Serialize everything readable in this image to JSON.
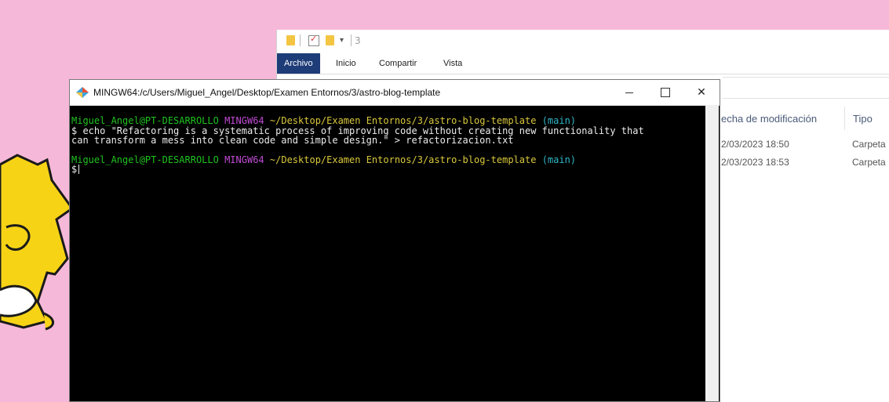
{
  "desktop": {
    "background": "#f6b8d8"
  },
  "explorer": {
    "qa_title": "3",
    "ribbon_tabs": [
      "Archivo",
      "Inicio",
      "Compartir",
      "Vista"
    ],
    "columns": {
      "date": "echa de modificación",
      "type": "Tipo"
    },
    "rows": [
      {
        "date": "2/03/2023 18:50",
        "type": "Carpeta"
      },
      {
        "date": "2/03/2023 18:53",
        "type": "Carpeta"
      }
    ],
    "accent": "#1e3c78"
  },
  "terminal": {
    "title": "MINGW64:/c/Users/Miguel_Angel/Desktop/Examen Entornos/3/astro-blog-template",
    "prompt1": {
      "user": "Miguel_Angel@PT-DESARROLLO",
      "shell": "MINGW64",
      "path": "~/Desktop/Examen Entornos/3/astro-blog-template",
      "branch": "(main)"
    },
    "command_line1": "$ echo \"Refactoring is a systematic process of improving code without creating new functionality that",
    "command_line2": "can transform a mess into clean code and simple design.\" > refactorizacion.txt",
    "prompt2": {
      "user": "Miguel_Angel@PT-DESARROLLO",
      "shell": "MINGW64",
      "path": "~/Desktop/Examen Entornos/3/astro-blog-template",
      "branch": "(main)"
    },
    "input_prompt": "$",
    "colors": {
      "user": "#1fc31f",
      "shell": "#c04bd4",
      "path": "#d9c83c",
      "branch": "#2fb7c7"
    }
  }
}
